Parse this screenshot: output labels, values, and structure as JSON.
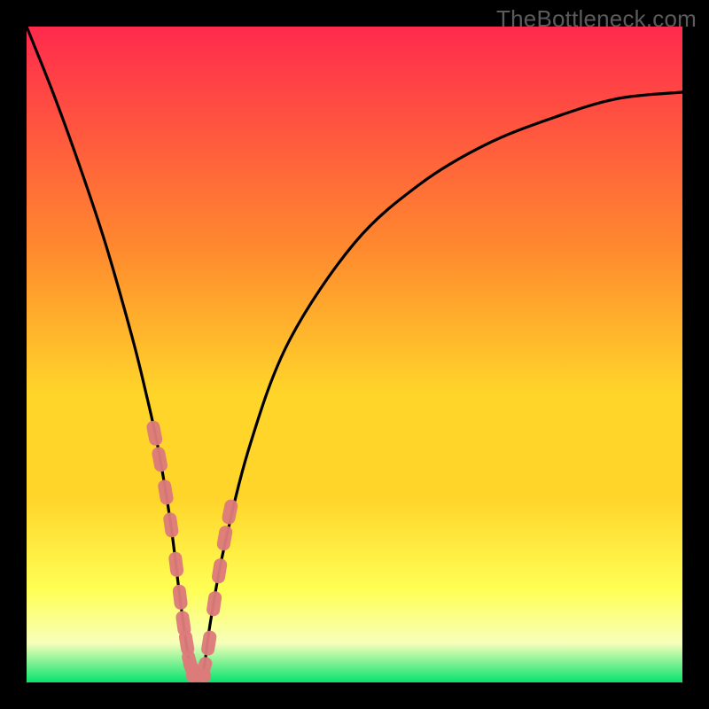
{
  "watermark": "TheBottleneck.com",
  "colors": {
    "bg": "#000000",
    "curve": "#000000",
    "marker_fill": "#dd7b7b",
    "marker_stroke": "#dd7b7b",
    "grad_top": "#ff2a4d",
    "grad_mid1": "#ff8a2e",
    "grad_mid2": "#ffd52a",
    "grad_mid3": "#ffff55",
    "grad_mid4": "#f7ffba",
    "grad_bottom": "#07e36e"
  },
  "chart_data": {
    "type": "line",
    "title": "",
    "xlabel": "",
    "ylabel": "",
    "xlim": [
      0,
      100
    ],
    "ylim": [
      0,
      100
    ],
    "series": [
      {
        "name": "bottleneck-curve",
        "x": [
          0,
          4,
          8,
          12,
          16,
          18,
          20,
          22,
          23.5,
          25,
          26,
          27,
          28,
          30,
          34,
          40,
          50,
          60,
          70,
          80,
          90,
          100
        ],
        "y": [
          100,
          90,
          79,
          67,
          53,
          45,
          36,
          24,
          12,
          2,
          0,
          2,
          9,
          20,
          36,
          52,
          67,
          76,
          82,
          86,
          89,
          90
        ]
      }
    ],
    "markers": {
      "name": "highlight-markers",
      "x": [
        19.5,
        20.3,
        21.2,
        22.0,
        22.8,
        23.4,
        23.9,
        24.4,
        24.9,
        25.4,
        26.2,
        27.0,
        27.8,
        28.6,
        29.4,
        30.2,
        31.0
      ],
      "y": [
        38,
        34,
        29,
        24,
        18,
        13,
        9,
        6,
        3,
        2,
        1,
        2,
        6,
        12,
        17,
        22,
        26
      ]
    }
  }
}
